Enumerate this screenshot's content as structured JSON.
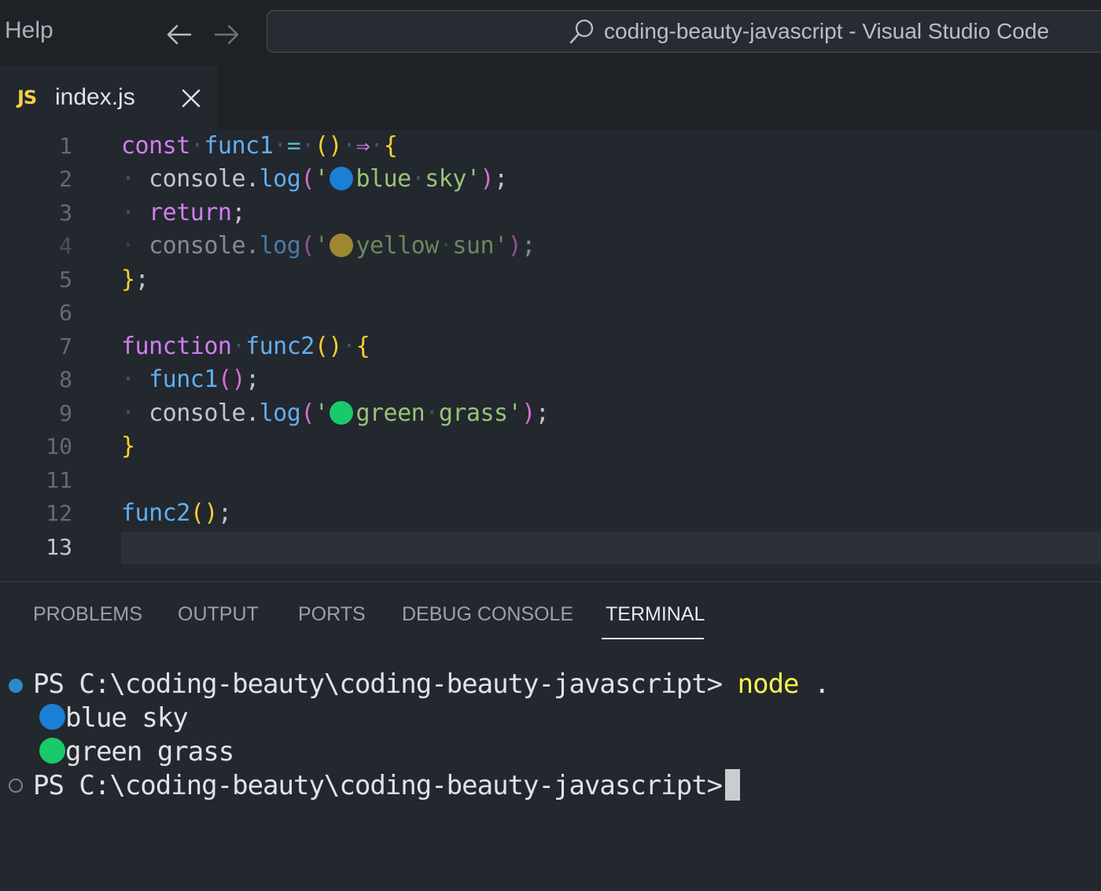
{
  "titlebar": {
    "menu_help": "Help",
    "window_title": "coding-beauty-javascript - Visual Studio Code"
  },
  "tab": {
    "icon": "JS",
    "label": "index.js"
  },
  "editor": {
    "line_numbers": [
      "1",
      "2",
      "3",
      "4",
      "5",
      "6",
      "7",
      "8",
      "9",
      "10",
      "11",
      "12",
      "13"
    ],
    "active_line": 13,
    "lines": [
      "const func1 = () => {",
      "  console.log('🔵blue sky');",
      "  return;",
      "  console.log('🟡yellow sun');",
      "};",
      "",
      "function func2() {",
      "  func1();",
      "  console.log('🟢green grass');",
      "}",
      "",
      "func2();",
      ""
    ],
    "tokens": {
      "l1": {
        "kw": "const",
        "name": "func1",
        "eq": "=",
        "parens": "()",
        "arrow": "⇒",
        "brace": "{"
      },
      "l2": {
        "obj": "console",
        "dot": ".",
        "method": "log",
        "open": "(",
        "q1": "'",
        "text1": "blue",
        "text2": "sky",
        "q2": "'",
        "close": ")",
        "semi": ";"
      },
      "l3": {
        "kw": "return",
        "semi": ";"
      },
      "l4": {
        "obj": "console",
        "dot": ".",
        "method": "log",
        "open": "(",
        "q1": "'",
        "text1": "yellow",
        "text2": "sun",
        "q2": "'",
        "close": ")",
        "semi": ";"
      },
      "l5": {
        "brace": "}",
        "semi": ";"
      },
      "l7": {
        "kw": "function",
        "name": "func2",
        "parens": "()",
        "brace": "{"
      },
      "l8": {
        "name": "func1",
        "parens": "()",
        "semi": ";"
      },
      "l9": {
        "obj": "console",
        "dot": ".",
        "method": "log",
        "open": "(",
        "q1": "'",
        "text1": "green",
        "text2": "grass",
        "q2": "'",
        "close": ")",
        "semi": ";"
      },
      "l10": {
        "brace": "}"
      },
      "l12": {
        "name": "func2",
        "parens": "()",
        "semi": ";"
      }
    },
    "emoji_colors": {
      "blue": "#1b7fd6",
      "yellow": "#b8982c",
      "green": "#19c96a"
    }
  },
  "panel": {
    "tabs": [
      "PROBLEMS",
      "OUTPUT",
      "PORTS",
      "DEBUG CONSOLE",
      "TERMINAL"
    ],
    "active_tab": "TERMINAL"
  },
  "terminal": {
    "prompt": "PS C:\\coding-beauty\\coding-beauty-javascript>",
    "command": "node",
    "command_arg": ".",
    "output": [
      "blue sky",
      "green grass"
    ]
  },
  "colors": {
    "background": "#23272e",
    "titlebar": "#1e2227",
    "accent_js": "#f2cf4a",
    "success_dot": "#2b8cc4"
  }
}
